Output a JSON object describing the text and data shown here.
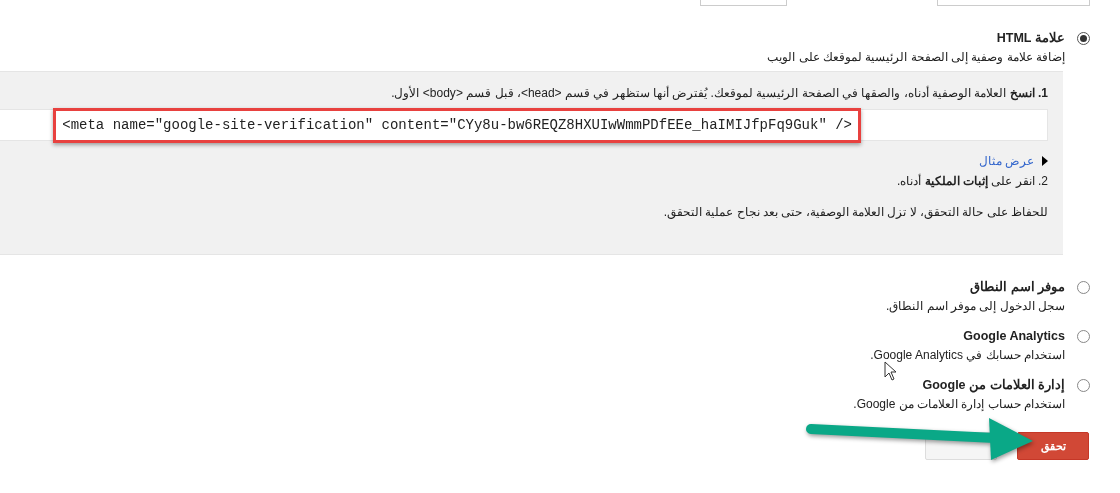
{
  "methods": [
    {
      "kind": "html_tag",
      "title": "علامة HTML",
      "description": "إضافة علامة وصفية إلى الصفحة الرئيسية لموقعك على الويب",
      "selected": true,
      "panel": {
        "step1": "**1. انسخ** العلامة الوصفية أدناه، والصقها في الصفحة الرئيسية لموقعك. يُفترض أنها ستظهر في قسم <head>، قبل قسم <body> الأول.",
        "code": "<meta name=\"google-site-verification\" content=\"CYy8u-bw6REQZ8HXUIwWmmPDfEEe_haIMIJfpFq9Guk\" />",
        "example_link": "عرض مثال",
        "step2": "2. انقر على **إثبات الملكية** أدناه.",
        "note": "للحفاظ على حالة التحقق، لا تزل العلامة الوصفية، حتى بعد نجاح عملية التحقق."
      }
    },
    {
      "kind": "option",
      "title": "موفر اسم النطاق",
      "description": "سجل الدخول إلى موفر اسم النطاق.",
      "selected": false
    },
    {
      "kind": "option",
      "title": "Google Analytics",
      "description": "استخدام حسابك في Google Analytics.",
      "selected": false
    },
    {
      "kind": "option",
      "title": "إدارة العلامات من Google",
      "description": "استخدام حساب إدارة العلامات من Google.",
      "selected": false
    }
  ],
  "buttons": [
    {
      "kind": "primary",
      "label": "تحقق"
    },
    {
      "kind": "secondary"
    }
  ]
}
